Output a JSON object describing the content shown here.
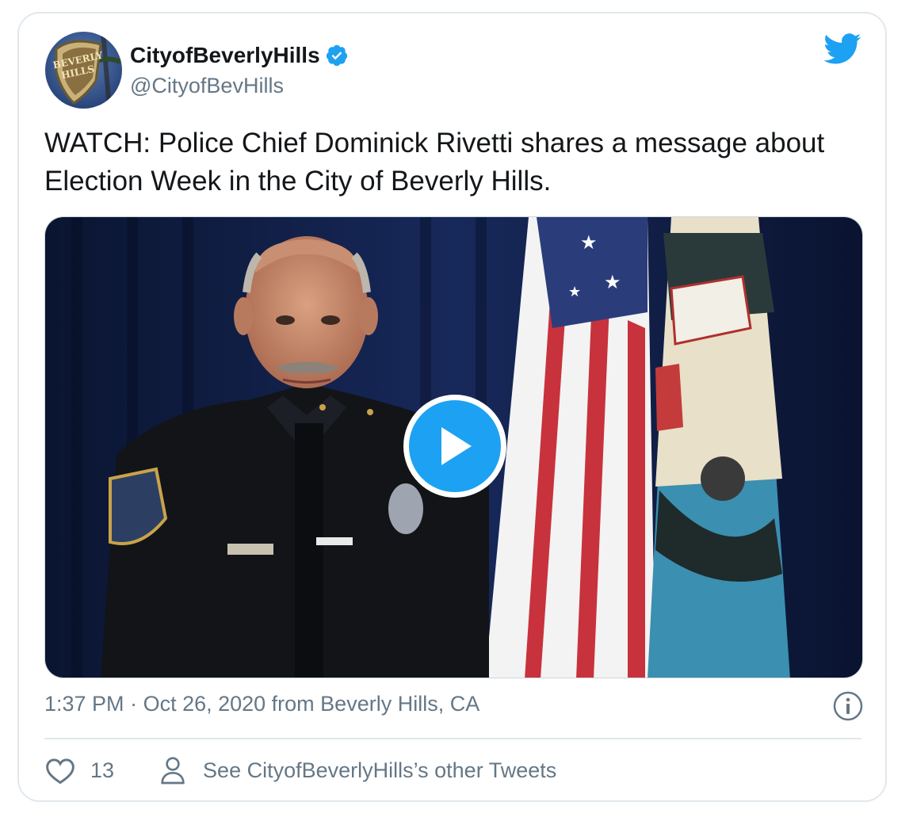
{
  "account": {
    "name": "CityofBeverlyHills",
    "handle": "@CityofBevHills",
    "avatar_text_line1": "BEVERLY",
    "avatar_text_line2": "HILLS",
    "verified_icon": "verified-badge-icon"
  },
  "tweet": {
    "text": "WATCH: Police Chief Dominick Rivetti shares a message about Election Week in the City of Beverly Hills.",
    "time": "1:37 PM",
    "separator": " · ",
    "date": "Oct 26, 2020",
    "source": " from Beverly Hills, CA"
  },
  "media": {
    "type": "video",
    "play_icon": "play-icon"
  },
  "actions": {
    "like_count": "13",
    "other_tweets_label": "See CityofBeverlyHills’s other Tweets"
  },
  "colors": {
    "brand_blue": "#1da1f2",
    "secondary_text": "#657786",
    "border": "#e1e8ed"
  }
}
